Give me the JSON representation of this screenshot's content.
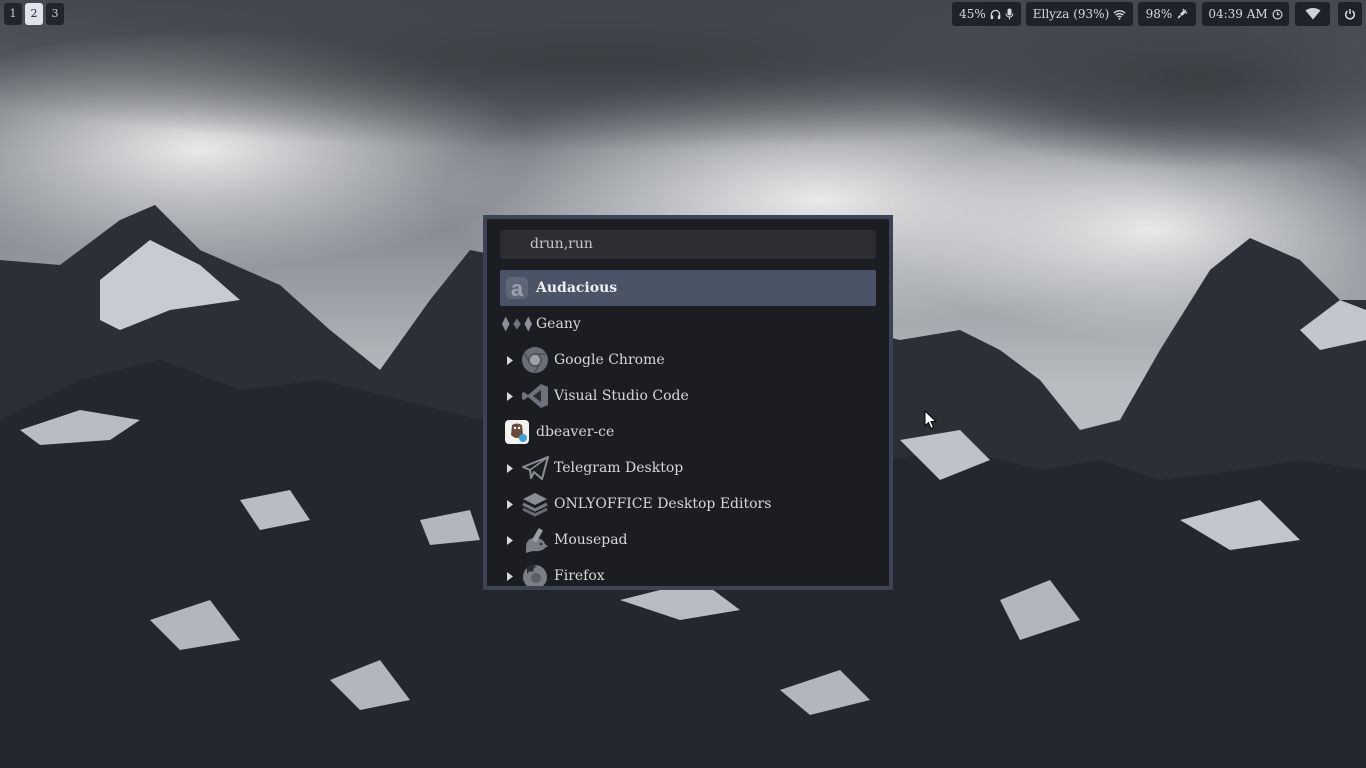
{
  "workspaces": [
    {
      "label": "1",
      "active": false
    },
    {
      "label": "2",
      "active": true
    },
    {
      "label": "3",
      "active": false
    }
  ],
  "topbar": {
    "volume": "45%",
    "bluetooth": "Ellyza (93%)",
    "battery": "98%",
    "clock": "04:39 AM"
  },
  "launcher": {
    "prompt": "drun,run",
    "entries": [
      {
        "label": "Audacious",
        "icon": "audacious-icon",
        "selected": true,
        "has_arrow": false
      },
      {
        "label": "Geany",
        "icon": "geany-icon",
        "selected": false,
        "has_arrow": false
      },
      {
        "label": "Google Chrome",
        "icon": "chrome-icon",
        "selected": false,
        "has_arrow": true
      },
      {
        "label": "Visual Studio Code",
        "icon": "vscode-icon",
        "selected": false,
        "has_arrow": true
      },
      {
        "label": "dbeaver-ce",
        "icon": "dbeaver-icon",
        "selected": false,
        "has_arrow": false
      },
      {
        "label": "Telegram Desktop",
        "icon": "telegram-icon",
        "selected": false,
        "has_arrow": true
      },
      {
        "label": "ONLYOFFICE Desktop Editors",
        "icon": "onlyoffice-icon",
        "selected": false,
        "has_arrow": true
      },
      {
        "label": "Mousepad",
        "icon": "mousepad-icon",
        "selected": false,
        "has_arrow": true
      },
      {
        "label": "Firefox",
        "icon": "firefox-icon",
        "selected": false,
        "has_arrow": true
      }
    ]
  },
  "colors": {
    "launcher_bg": "#1c1d20",
    "launcher_border": "#3c4352",
    "selected_bg": "#4b5467",
    "bar_bg": "#1f2227"
  }
}
